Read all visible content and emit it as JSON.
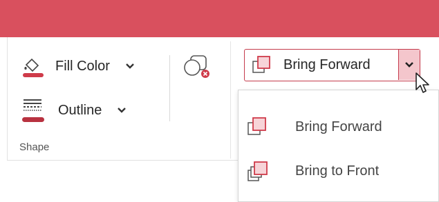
{
  "ribbon": {
    "fill_color_label": "Fill Color",
    "outline_label": "Outline",
    "group_label": "Shape"
  },
  "arrange": {
    "bring_forward_label": "Bring Forward"
  },
  "dropdown": {
    "items": [
      {
        "label": "Bring Forward",
        "icon": "bring-forward-icon"
      },
      {
        "label": "Bring to Front",
        "icon": "bring-to-front-icon"
      }
    ]
  },
  "colors": {
    "accent": "#d9505e",
    "button_border": "#c43a4b",
    "dropdown_hover": "#f4c6cc",
    "icon_red": "#cf3b4a"
  }
}
